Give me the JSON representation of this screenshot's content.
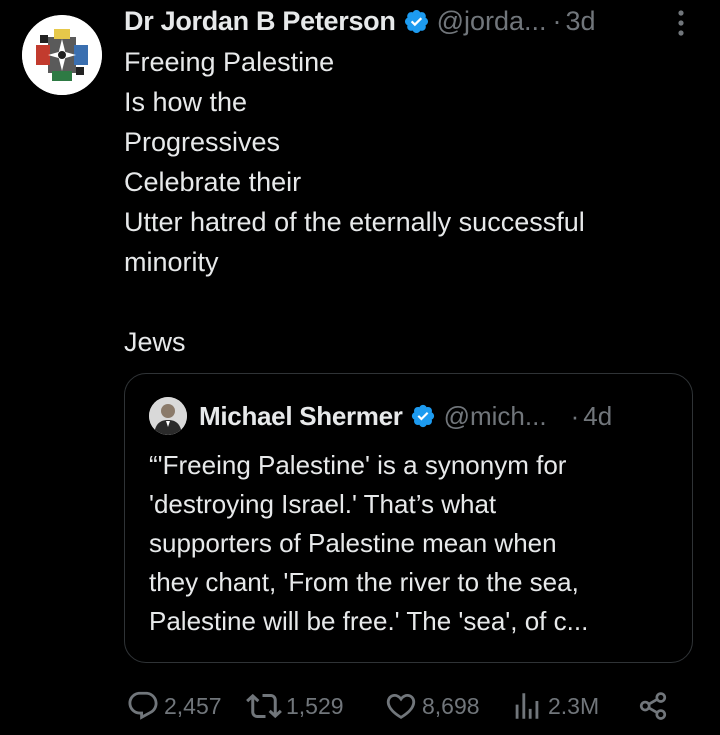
{
  "tweet": {
    "author_name": "Dr Jordan B Peterson",
    "handle": "@jorda...",
    "separator": "·",
    "time": "3d",
    "text_lines": [
      "Freeing Palestine",
      "Is how the",
      "Progressives",
      "Celebrate their",
      "Utter hatred of the eternally successful",
      "minority",
      "",
      "Jews"
    ],
    "avatar_icon": "emblem-avatar-icon",
    "verified_icon": "verified-badge-icon",
    "more_icon": "more-vertical-icon"
  },
  "quote": {
    "author_name": "Michael Shermer",
    "handle": "@mich...",
    "separator": "·",
    "time": "4d",
    "text_lines": [
      "“'Freeing Palestine' is a synonym for",
      "'destroying Israel.' That’s what",
      "supporters of Palestine mean when",
      "they chant, 'From the river to the sea,",
      "Palestine will be free.'  The 'sea', of c..."
    ]
  },
  "actions": {
    "replies": "2,457",
    "reposts": "1,529",
    "likes": "8,698",
    "views": "2.3M"
  },
  "colors": {
    "background": "#000000",
    "text": "#e7e9ea",
    "secondary": "#71767b",
    "verified": "#1d9bf0",
    "border": "#2f3336"
  }
}
